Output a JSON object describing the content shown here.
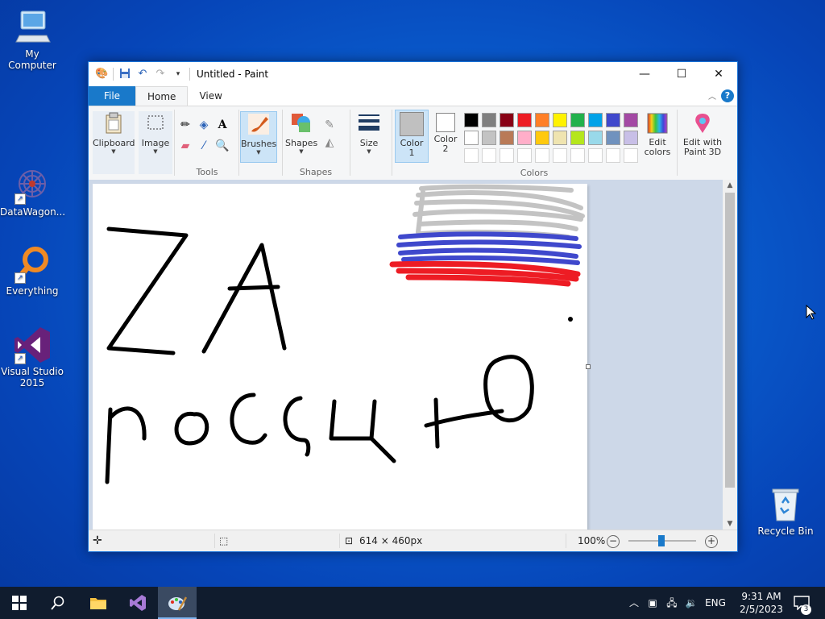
{
  "desktop": {
    "icons": [
      {
        "label": "My Computer"
      },
      {
        "label": "DataWagon..."
      },
      {
        "label": "Everything"
      },
      {
        "label": "Visual Studio 2015"
      },
      {
        "label": "Recycle Bin"
      }
    ]
  },
  "window": {
    "title": "Untitled - Paint",
    "controls": {
      "minimize": "—",
      "maximize": "☐",
      "close": "✕"
    },
    "tabs": {
      "file": "File",
      "home": "Home",
      "view": "View"
    },
    "ribbon": {
      "clipboard": "Clipboard",
      "image": "Image",
      "tools_group": "Tools",
      "brushes": "Brushes",
      "shapes": "Shapes",
      "shapes_group": "Shapes",
      "size": "Size",
      "color1": "Color\n1",
      "color2": "Color\n2",
      "colors_group": "Colors",
      "edit_colors": "Edit\ncolors",
      "paint3d": "Edit with\nPaint 3D"
    },
    "palette_row1": [
      "#000000",
      "#7f7f7f",
      "#880015",
      "#ed1c24",
      "#ff7f27",
      "#fff200",
      "#22b14c",
      "#00a2e8",
      "#3f48cc",
      "#a349a4"
    ],
    "palette_row2": [
      "#ffffff",
      "#c3c3c3",
      "#b97a57",
      "#ffaec9",
      "#ffc90e",
      "#efe4b0",
      "#b5e61d",
      "#99d9ea",
      "#7092be",
      "#c8bfe7"
    ],
    "color1_value": "#c0c0c0",
    "color2_value": "#ffffff",
    "status": {
      "dimensions": "614 × 460px",
      "zoom": "100%"
    },
    "canvas_text": {
      "line1": "ZA",
      "line2": "россию"
    }
  },
  "taskbar": {
    "lang": "ENG",
    "time": "9:31 AM",
    "date": "2/5/2023",
    "notifications": "3"
  }
}
